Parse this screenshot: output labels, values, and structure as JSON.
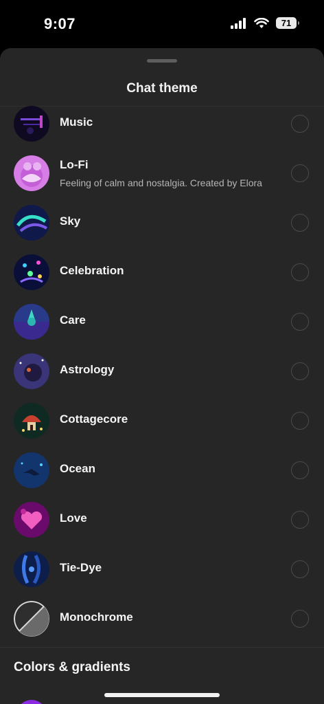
{
  "status": {
    "time": "9:07",
    "battery": "71"
  },
  "sheet": {
    "title": "Chat theme"
  },
  "themes": [
    {
      "name": "Music",
      "subtitle": ""
    },
    {
      "name": "Lo-Fi",
      "subtitle": "Feeling of calm and nostalgia. Created by Elora"
    },
    {
      "name": "Sky",
      "subtitle": ""
    },
    {
      "name": "Celebration",
      "subtitle": ""
    },
    {
      "name": "Care",
      "subtitle": ""
    },
    {
      "name": "Astrology",
      "subtitle": ""
    },
    {
      "name": "Cottagecore",
      "subtitle": ""
    },
    {
      "name": "Ocean",
      "subtitle": ""
    },
    {
      "name": "Love",
      "subtitle": ""
    },
    {
      "name": "Tie-Dye",
      "subtitle": ""
    },
    {
      "name": "Monochrome",
      "subtitle": ""
    }
  ],
  "section": {
    "title": "Colors & gradients"
  },
  "colors": {
    "sheet_bg": "#262626",
    "text": "#f5f5f5",
    "subtext": "#b5b5b5",
    "radio_border": "#4a4a4a"
  }
}
